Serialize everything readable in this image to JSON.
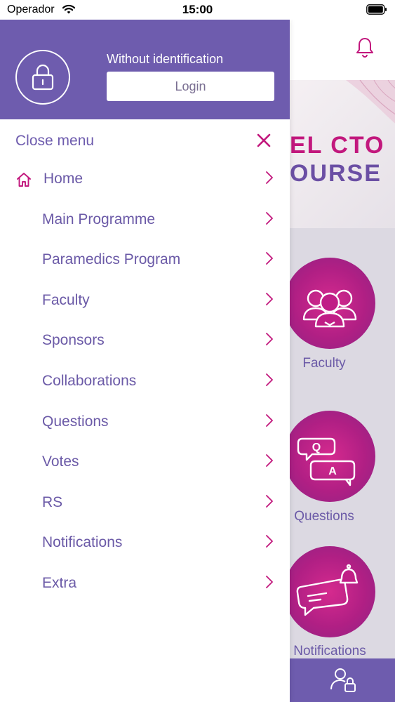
{
  "status_bar": {
    "carrier": "Operador",
    "time": "15:00"
  },
  "drawer": {
    "identification_text": "Without identification",
    "login_label": "Login",
    "close_label": "Close menu",
    "items": [
      {
        "label": "Home",
        "icon": "home-icon"
      },
      {
        "label": "Main Programme"
      },
      {
        "label": "Paramedics Program"
      },
      {
        "label": "Faculty"
      },
      {
        "label": "Sponsors"
      },
      {
        "label": "Collaborations"
      },
      {
        "label": "Questions"
      },
      {
        "label": "Votes"
      },
      {
        "label": "RS"
      },
      {
        "label": "Notifications"
      },
      {
        "label": "Extra"
      }
    ]
  },
  "background": {
    "banner_line1": "EL CTO",
    "banner_line2": "OURSE",
    "tiles": [
      {
        "label": "Faculty",
        "icon": "faculty-icon"
      },
      {
        "label": "Questions",
        "icon": "qa-icon"
      },
      {
        "label": "Notifications",
        "icon": "notification-bubble-icon"
      }
    ]
  },
  "colors": {
    "primary": "#6e5cae",
    "accent": "#c2187d",
    "text": "#6b5aa7"
  }
}
